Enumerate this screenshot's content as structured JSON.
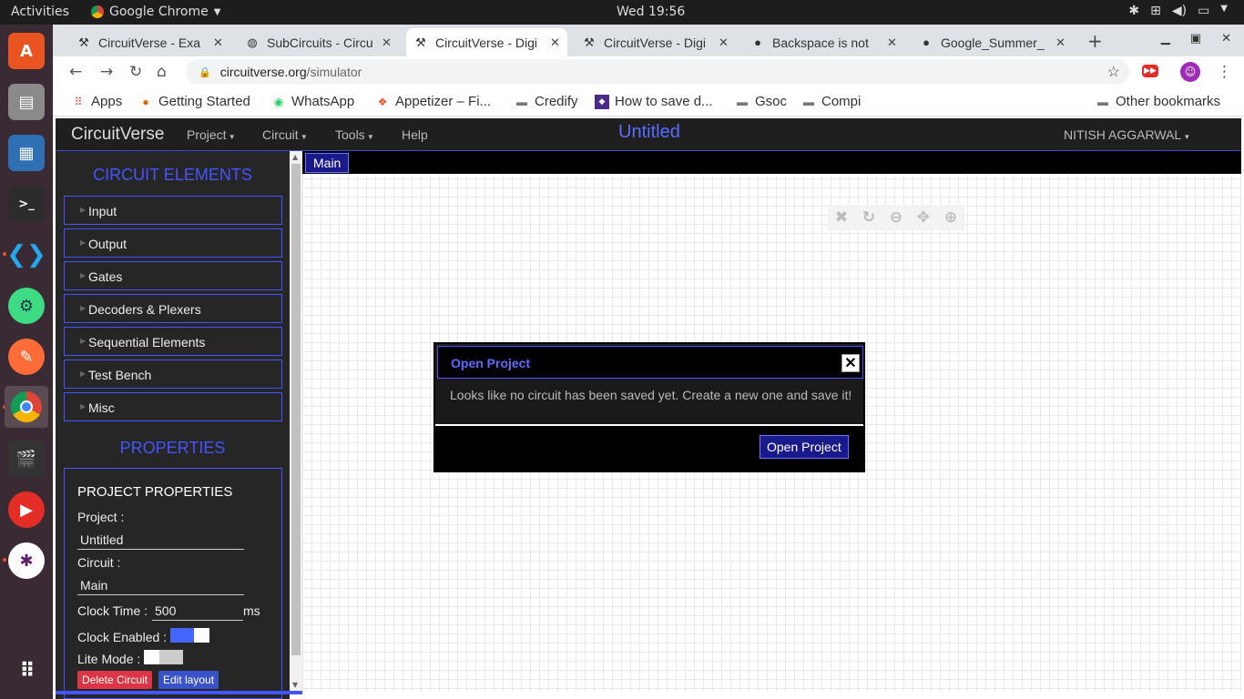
{
  "ubuntu": {
    "activities": "Activities",
    "app_name": "Google Chrome",
    "clock": "Wed 19:56"
  },
  "tabs": [
    {
      "title": "CircuitVerse - Exa",
      "icon": "circuitverse-icon"
    },
    {
      "title": "SubCircuits - Circu",
      "icon": "globe-icon"
    },
    {
      "title": "CircuitVerse - Digi",
      "icon": "circuitverse-icon",
      "active": true
    },
    {
      "title": "CircuitVerse - Digi",
      "icon": "circuitverse-icon"
    },
    {
      "title": "Backspace is not",
      "icon": "github-icon"
    },
    {
      "title": "Google_Summer_",
      "icon": "github-icon"
    }
  ],
  "address": {
    "host": "circuitverse.org",
    "path": "/simulator"
  },
  "bookmarks": [
    {
      "label": "Apps"
    },
    {
      "label": "Getting Started"
    },
    {
      "label": "WhatsApp"
    },
    {
      "label": "Appetizer – Fi..."
    },
    {
      "label": "Credify"
    },
    {
      "label": "How to save d..."
    },
    {
      "label": "Gsoc"
    },
    {
      "label": "Compi"
    },
    {
      "label": "Other bookmarks"
    }
  ],
  "cv": {
    "brand": "CircuitVerse",
    "menu": [
      "Project",
      "Circuit",
      "Tools",
      "Help"
    ],
    "project_title": "Untitled",
    "user": "NITISH AGGARWAL"
  },
  "sidebar": {
    "elements_heading": "CIRCUIT ELEMENTS",
    "elements": [
      "Input",
      "Output",
      "Gates",
      "Decoders & Plexers",
      "Sequential Elements",
      "Test Bench",
      "Misc"
    ],
    "properties_heading": "PROPERTIES",
    "project_properties": "PROJECT PROPERTIES",
    "project_label": "Project :",
    "project_value": "Untitled",
    "circuit_label": "Circuit :",
    "circuit_value": "Main",
    "clock_time_label": "Clock Time :",
    "clock_time_value": "500",
    "clock_time_unit": "ms",
    "clock_enabled_label": "Clock Enabled :",
    "clock_enabled": true,
    "lite_mode_label": "Lite Mode :",
    "lite_mode": false,
    "delete_button": "Delete Circuit",
    "edit_layout_button": "Edit layout"
  },
  "circuit_tab": "Main",
  "modal": {
    "title": "Open Project",
    "close": "✕",
    "message": "Looks like no circuit has been saved yet. Create a new one and save it!",
    "button": "Open Project"
  },
  "colors": {
    "accent": "#4455ff",
    "panel_bg": "#262626",
    "delete": "#dc3545"
  }
}
